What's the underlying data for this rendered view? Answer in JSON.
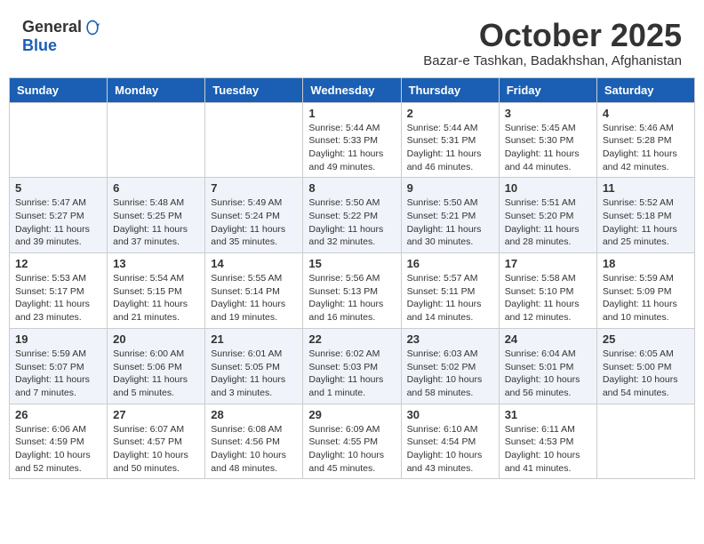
{
  "header": {
    "logo_general": "General",
    "logo_blue": "Blue",
    "month_title": "October 2025",
    "location": "Bazar-e Tashkan, Badakhshan, Afghanistan"
  },
  "weekdays": [
    "Sunday",
    "Monday",
    "Tuesday",
    "Wednesday",
    "Thursday",
    "Friday",
    "Saturday"
  ],
  "weeks": [
    [
      {
        "day": "",
        "info": ""
      },
      {
        "day": "",
        "info": ""
      },
      {
        "day": "",
        "info": ""
      },
      {
        "day": "1",
        "info": "Sunrise: 5:44 AM\nSunset: 5:33 PM\nDaylight: 11 hours\nand 49 minutes."
      },
      {
        "day": "2",
        "info": "Sunrise: 5:44 AM\nSunset: 5:31 PM\nDaylight: 11 hours\nand 46 minutes."
      },
      {
        "day": "3",
        "info": "Sunrise: 5:45 AM\nSunset: 5:30 PM\nDaylight: 11 hours\nand 44 minutes."
      },
      {
        "day": "4",
        "info": "Sunrise: 5:46 AM\nSunset: 5:28 PM\nDaylight: 11 hours\nand 42 minutes."
      }
    ],
    [
      {
        "day": "5",
        "info": "Sunrise: 5:47 AM\nSunset: 5:27 PM\nDaylight: 11 hours\nand 39 minutes."
      },
      {
        "day": "6",
        "info": "Sunrise: 5:48 AM\nSunset: 5:25 PM\nDaylight: 11 hours\nand 37 minutes."
      },
      {
        "day": "7",
        "info": "Sunrise: 5:49 AM\nSunset: 5:24 PM\nDaylight: 11 hours\nand 35 minutes."
      },
      {
        "day": "8",
        "info": "Sunrise: 5:50 AM\nSunset: 5:22 PM\nDaylight: 11 hours\nand 32 minutes."
      },
      {
        "day": "9",
        "info": "Sunrise: 5:50 AM\nSunset: 5:21 PM\nDaylight: 11 hours\nand 30 minutes."
      },
      {
        "day": "10",
        "info": "Sunrise: 5:51 AM\nSunset: 5:20 PM\nDaylight: 11 hours\nand 28 minutes."
      },
      {
        "day": "11",
        "info": "Sunrise: 5:52 AM\nSunset: 5:18 PM\nDaylight: 11 hours\nand 25 minutes."
      }
    ],
    [
      {
        "day": "12",
        "info": "Sunrise: 5:53 AM\nSunset: 5:17 PM\nDaylight: 11 hours\nand 23 minutes."
      },
      {
        "day": "13",
        "info": "Sunrise: 5:54 AM\nSunset: 5:15 PM\nDaylight: 11 hours\nand 21 minutes."
      },
      {
        "day": "14",
        "info": "Sunrise: 5:55 AM\nSunset: 5:14 PM\nDaylight: 11 hours\nand 19 minutes."
      },
      {
        "day": "15",
        "info": "Sunrise: 5:56 AM\nSunset: 5:13 PM\nDaylight: 11 hours\nand 16 minutes."
      },
      {
        "day": "16",
        "info": "Sunrise: 5:57 AM\nSunset: 5:11 PM\nDaylight: 11 hours\nand 14 minutes."
      },
      {
        "day": "17",
        "info": "Sunrise: 5:58 AM\nSunset: 5:10 PM\nDaylight: 11 hours\nand 12 minutes."
      },
      {
        "day": "18",
        "info": "Sunrise: 5:59 AM\nSunset: 5:09 PM\nDaylight: 11 hours\nand 10 minutes."
      }
    ],
    [
      {
        "day": "19",
        "info": "Sunrise: 5:59 AM\nSunset: 5:07 PM\nDaylight: 11 hours\nand 7 minutes."
      },
      {
        "day": "20",
        "info": "Sunrise: 6:00 AM\nSunset: 5:06 PM\nDaylight: 11 hours\nand 5 minutes."
      },
      {
        "day": "21",
        "info": "Sunrise: 6:01 AM\nSunset: 5:05 PM\nDaylight: 11 hours\nand 3 minutes."
      },
      {
        "day": "22",
        "info": "Sunrise: 6:02 AM\nSunset: 5:03 PM\nDaylight: 11 hours\nand 1 minute."
      },
      {
        "day": "23",
        "info": "Sunrise: 6:03 AM\nSunset: 5:02 PM\nDaylight: 10 hours\nand 58 minutes."
      },
      {
        "day": "24",
        "info": "Sunrise: 6:04 AM\nSunset: 5:01 PM\nDaylight: 10 hours\nand 56 minutes."
      },
      {
        "day": "25",
        "info": "Sunrise: 6:05 AM\nSunset: 5:00 PM\nDaylight: 10 hours\nand 54 minutes."
      }
    ],
    [
      {
        "day": "26",
        "info": "Sunrise: 6:06 AM\nSunset: 4:59 PM\nDaylight: 10 hours\nand 52 minutes."
      },
      {
        "day": "27",
        "info": "Sunrise: 6:07 AM\nSunset: 4:57 PM\nDaylight: 10 hours\nand 50 minutes."
      },
      {
        "day": "28",
        "info": "Sunrise: 6:08 AM\nSunset: 4:56 PM\nDaylight: 10 hours\nand 48 minutes."
      },
      {
        "day": "29",
        "info": "Sunrise: 6:09 AM\nSunset: 4:55 PM\nDaylight: 10 hours\nand 45 minutes."
      },
      {
        "day": "30",
        "info": "Sunrise: 6:10 AM\nSunset: 4:54 PM\nDaylight: 10 hours\nand 43 minutes."
      },
      {
        "day": "31",
        "info": "Sunrise: 6:11 AM\nSunset: 4:53 PM\nDaylight: 10 hours\nand 41 minutes."
      },
      {
        "day": "",
        "info": ""
      }
    ]
  ]
}
